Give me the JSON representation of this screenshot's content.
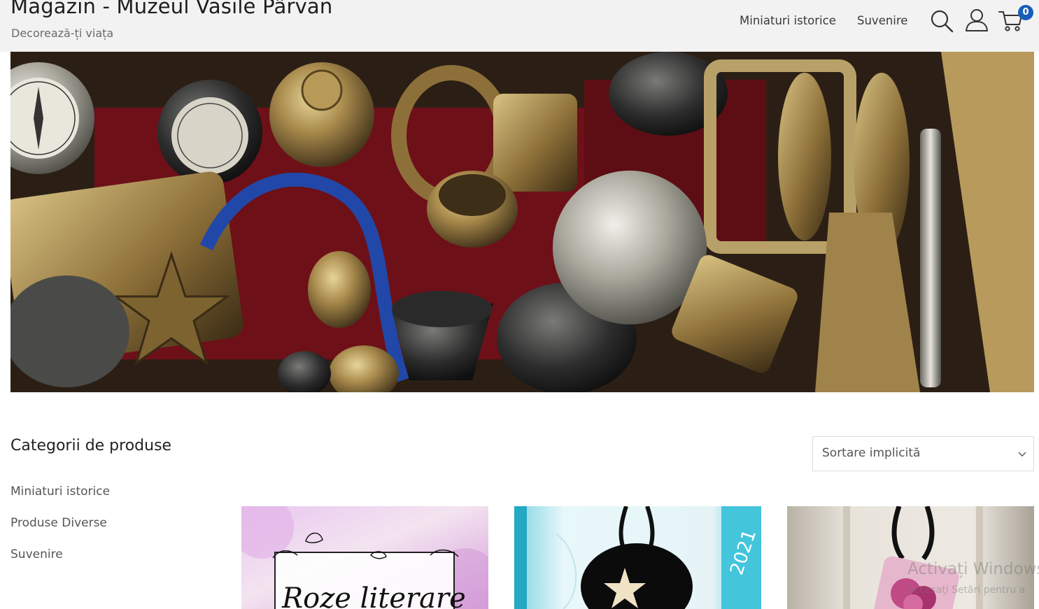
{
  "header": {
    "site_title": "Magazin - Muzeul Vasile Pârvan",
    "tagline": "Decorează-ți viața",
    "nav": [
      "Miniaturi istorice",
      "Suvenire"
    ],
    "icons": [
      "search-icon",
      "user-icon",
      "cart-icon"
    ],
    "cart_count": "0",
    "badge_color": "#1a5eb8"
  },
  "sidebar": {
    "title": "Categorii de produse",
    "items": [
      "Miniaturi istorice",
      "Produse Diverse",
      "Suvenire"
    ]
  },
  "sort": {
    "selected": "Sortare implicită"
  },
  "products": [
    {
      "image_text": "Roze literare"
    },
    {
      "image_text": "2021"
    },
    {
      "image_text": ""
    }
  ],
  "watermark": {
    "line1": "Activați Windows",
    "line2": "Accesați Setări pentru a"
  }
}
